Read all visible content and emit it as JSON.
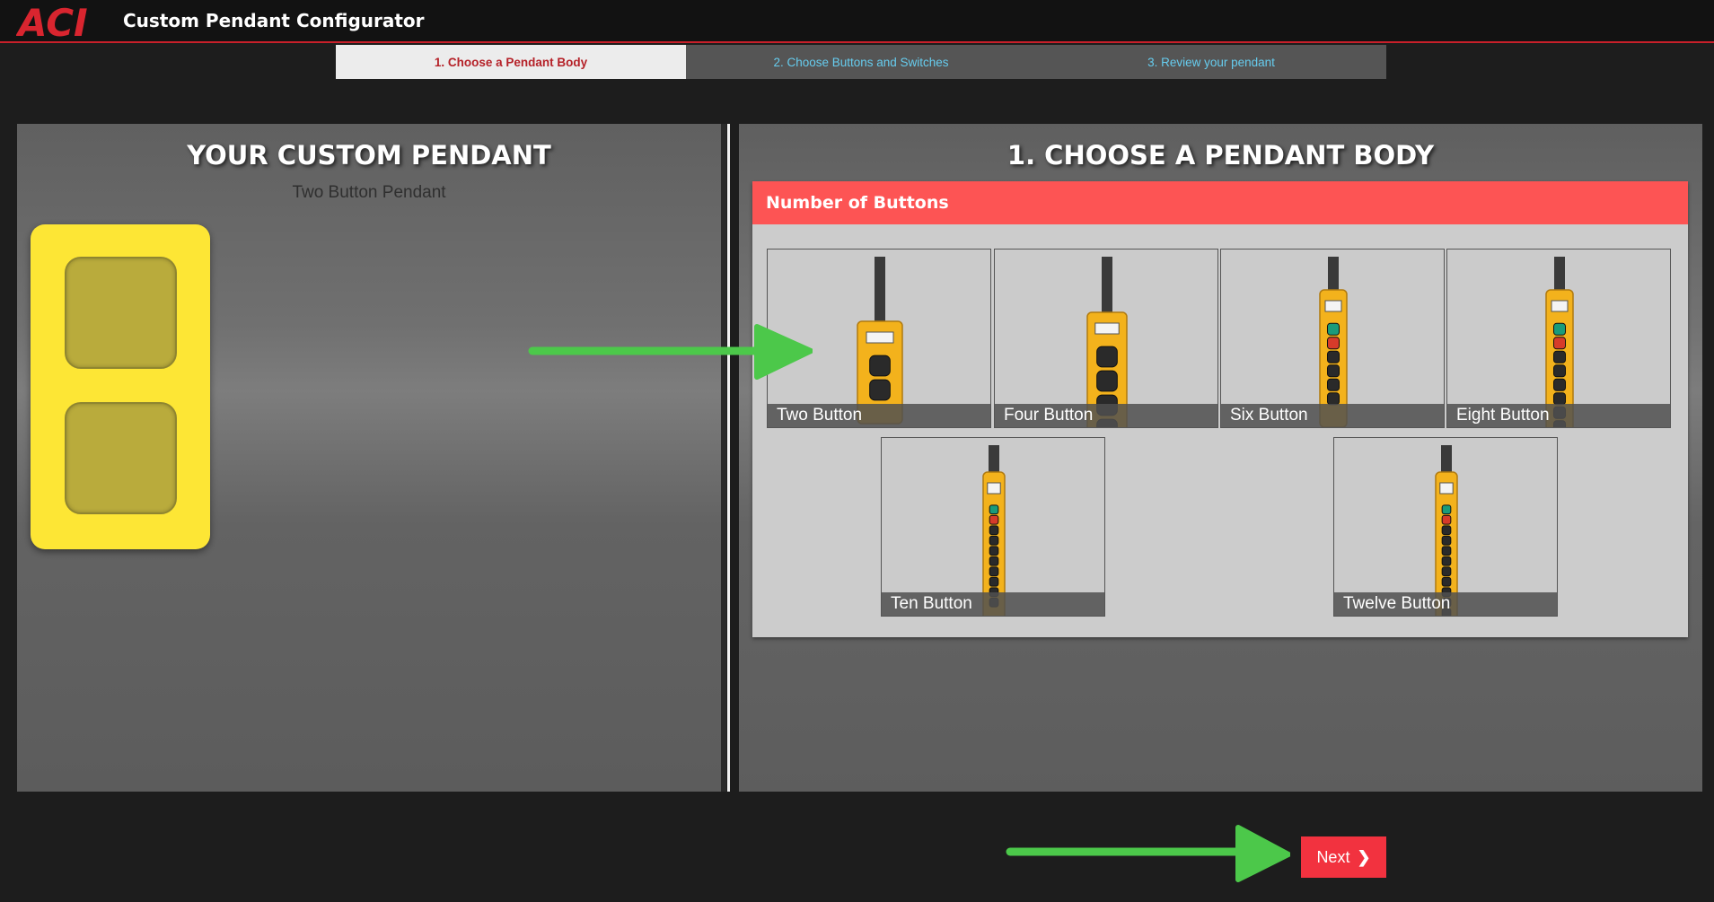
{
  "header": {
    "logo_text": "ACI",
    "title": "Custom Pendant Configurator"
  },
  "steps": [
    {
      "label": "1. Choose a Pendant Body"
    },
    {
      "label": "2. Choose Buttons and Switches"
    },
    {
      "label": "3. Review your pendant"
    }
  ],
  "left_panel": {
    "title": "YOUR CUSTOM PENDANT",
    "subtitle": "Two Button Pendant",
    "preview_button_count": 2
  },
  "right_panel": {
    "title": "1. CHOOSE A PENDANT BODY",
    "card_title": "Number of Buttons",
    "options": [
      {
        "label": "Two Button",
        "buttons": 2
      },
      {
        "label": "Four Button",
        "buttons": 4
      },
      {
        "label": "Six Button",
        "buttons": 6
      },
      {
        "label": "Eight Button",
        "buttons": 8
      },
      {
        "label": "Ten Button",
        "buttons": 10
      },
      {
        "label": "Twelve Button",
        "buttons": 12
      }
    ]
  },
  "footer": {
    "next_label": "Next",
    "next_icon": "chevron-right-icon"
  },
  "colors": {
    "brand_red": "#c8202a",
    "card_header": "#fd5454",
    "next_button": "#f2323f",
    "pendant_yellow": "#fde635",
    "arrow_green": "#4cc84a",
    "step_link": "#66ccee"
  }
}
